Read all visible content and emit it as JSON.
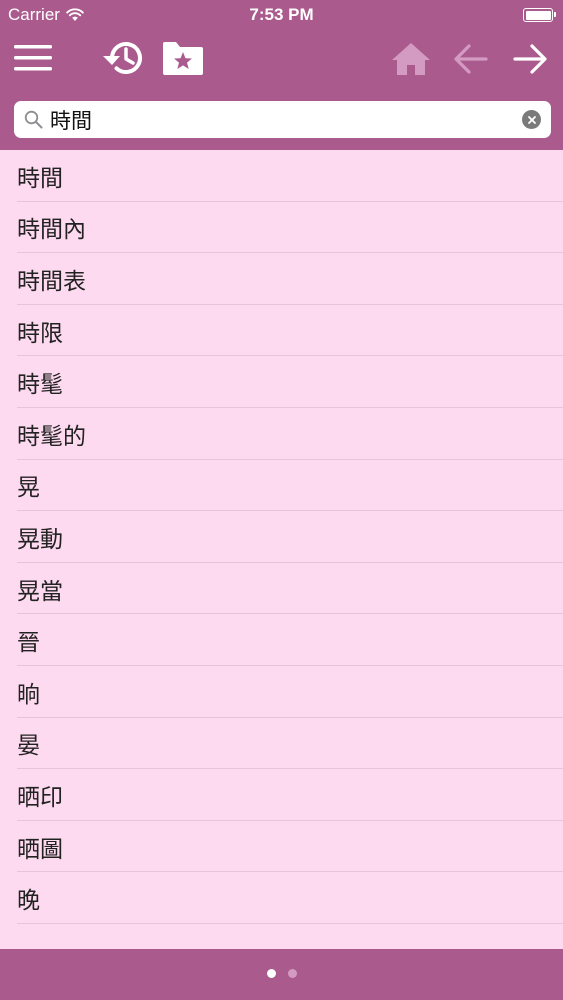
{
  "status_bar": {
    "carrier": "Carrier",
    "time": "7:53 PM",
    "icons": [
      "wifi-icon",
      "battery-icon"
    ]
  },
  "toolbar": {
    "buttons": [
      {
        "name": "menu",
        "icon": "hamburger-icon"
      },
      {
        "name": "history",
        "icon": "history-icon"
      },
      {
        "name": "favorites",
        "icon": "folder-star-icon"
      },
      {
        "name": "home",
        "icon": "home-icon",
        "enabled": false
      },
      {
        "name": "back",
        "icon": "arrow-left-icon",
        "enabled": false
      },
      {
        "name": "forward",
        "icon": "arrow-right-icon",
        "enabled": true
      }
    ]
  },
  "search": {
    "value": "時間",
    "placeholder": ""
  },
  "results": [
    "時間",
    "時間內",
    "時間表",
    "時限",
    "時髦",
    "時髦的",
    "晃",
    "晃動",
    "晃當",
    "晉",
    "晌",
    "晏",
    "晒印",
    "晒圖",
    "晚"
  ],
  "pager": {
    "total": 2,
    "current": 1
  },
  "colors": {
    "accent": "#ab5a8e",
    "list_background": "#fddaf0",
    "divider": "#e9c3da",
    "icon_disabled": "#d39bc2",
    "icon_enabled": "#ffffff"
  }
}
